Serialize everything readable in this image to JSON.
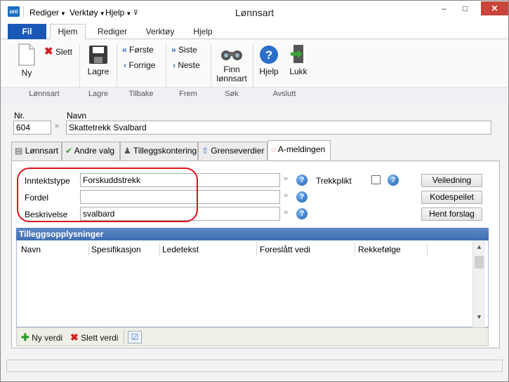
{
  "titlebar": {
    "app_logo": "uni",
    "menus": [
      "Rediger",
      "Verktøy",
      "Hjelp"
    ],
    "title": "Lønnsart",
    "minimize": "–",
    "maximize": "□",
    "close": "✕"
  },
  "ribbon_tabs": {
    "file": "Fil",
    "tabs": [
      "Hjem",
      "Rediger",
      "Verktøy",
      "Hjelp"
    ]
  },
  "ribbon": {
    "new": "Ny",
    "delete": "Slett",
    "save": "Lagre",
    "first": "Første",
    "previous": "Forrige",
    "last": "Siste",
    "next": "Neste",
    "find": "Finn lønnsart",
    "help": "Hjelp",
    "close": "Lukk",
    "groups": [
      "Lønnsart",
      "Lagre",
      "Tilbake",
      "Frem",
      "Søk",
      "Avslutt"
    ]
  },
  "header": {
    "nr_label": "Nr.",
    "nr_value": "604",
    "name_label": "Navn",
    "name_value": "Skattetrekk Svalbard",
    "arrow": "»"
  },
  "page_tabs": [
    "Lønnsart",
    "Andre valg",
    "Tilleggskontering",
    "Grenseverdier",
    "A-meldingen"
  ],
  "amelding": {
    "inntektstype_label": "Inntektstype",
    "inntektstype_value": "Forskuddstrekk",
    "fordel_label": "Fordel",
    "fordel_value": "",
    "beskrivelse_label": "Beskrivelse",
    "beskrivelse_value": "svalbard",
    "trekkplikt_label": "Trekkplikt",
    "trekkplikt_checked": false,
    "help_glyph": "?",
    "arrow": "»",
    "buttons": [
      "Veiledning",
      "Kodespeilet",
      "Hent forslag"
    ]
  },
  "grid": {
    "title": "Tilleggsopplysninger",
    "columns": [
      "Navn",
      "Spesifikasjon",
      "Ledetekst",
      "Foreslått vedi",
      "Rekkefølge"
    ]
  },
  "footer": {
    "add": "Ny verdi",
    "delete": "Slett verdi"
  },
  "colors": {
    "accent": "#1b58b6",
    "highlight": "#e0101a",
    "grid_header": "#4a78bb"
  }
}
